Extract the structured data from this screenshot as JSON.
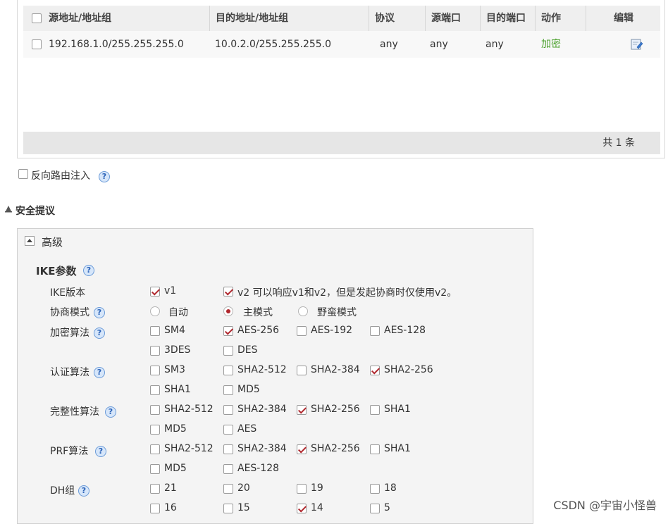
{
  "policy_table": {
    "headers": {
      "source": "源地址/地址组",
      "dest": "目的地址/地址组",
      "protocol": "协议",
      "src_port": "源端口",
      "dst_port": "目的端口",
      "action": "动作",
      "edit": "编辑"
    },
    "rows": [
      {
        "source": "192.168.1.0/255.255.255.0",
        "dest": "10.0.2.0/255.255.255.0",
        "protocol": "any",
        "src_port": "any",
        "dst_port": "any",
        "action": "加密"
      }
    ],
    "footer_count": "共 1 条"
  },
  "reverse_route": {
    "label": "反向路由注入",
    "checked": false
  },
  "section": {
    "title": "安全提议"
  },
  "advanced": {
    "title": "高级",
    "ike_title": "IKE参数",
    "ike_version": {
      "label": "IKE版本",
      "v1": "v1",
      "v2": "v2  可以响应v1和v2，但是发起协商时仅使用v2。"
    },
    "negotiation_mode": {
      "label": "协商模式",
      "options": [
        "自动",
        "主模式",
        "野蛮模式"
      ],
      "selected": "主模式"
    },
    "encryption": {
      "label": "加密算法",
      "options": [
        "SM4",
        "AES-256",
        "AES-192",
        "AES-128",
        "3DES",
        "DES"
      ],
      "checked": [
        "AES-256"
      ]
    },
    "authentication": {
      "label": "认证算法",
      "options": [
        "SM3",
        "SHA2-512",
        "SHA2-384",
        "SHA2-256",
        "SHA1",
        "MD5"
      ],
      "checked": [
        "SHA2-256"
      ]
    },
    "integrity": {
      "label": "完整性算法",
      "options": [
        "SHA2-512",
        "SHA2-384",
        "SHA2-256",
        "SHA1",
        "MD5",
        "AES"
      ],
      "checked": [
        "SHA2-256"
      ]
    },
    "prf": {
      "label": "PRF算法",
      "options": [
        "SHA2-512",
        "SHA2-384",
        "SHA2-256",
        "SHA1",
        "MD5",
        "AES-128"
      ],
      "checked": [
        "SHA2-256"
      ]
    },
    "dh": {
      "label": "DH组",
      "options": [
        "21",
        "20",
        "19",
        "18",
        "16",
        "15",
        "14",
        "5"
      ],
      "checked": [
        "14"
      ]
    }
  },
  "help_glyph": "?",
  "watermark": "CSDN @宇宙小怪兽",
  "colors": {
    "check_mark": "#b0272d",
    "action_green": "#4aa02c",
    "help_blue": "#2d64b8"
  }
}
